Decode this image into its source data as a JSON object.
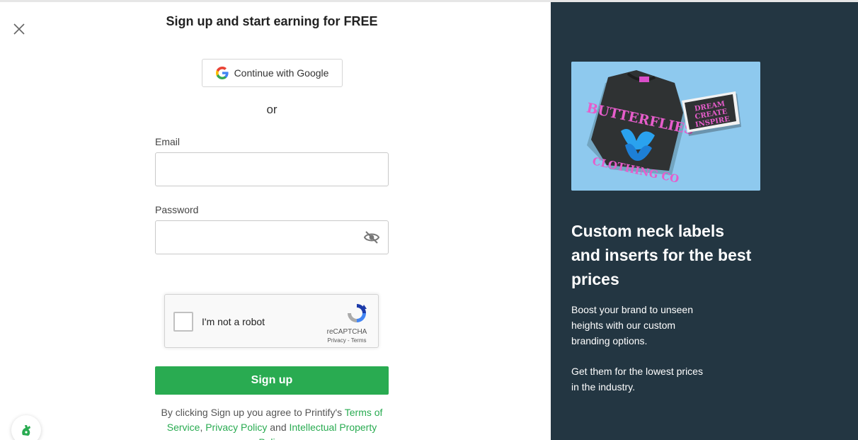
{
  "dialog": {
    "title": "Sign up and start earning for FREE",
    "google_label": "Continue with Google",
    "or_label": "or"
  },
  "form": {
    "email_label": "Email",
    "email_value": "",
    "password_label": "Password",
    "password_value": "",
    "captcha_label": "I'm not a robot",
    "captcha_brand": "reCAPTCHA",
    "captcha_links": "Privacy - Terms",
    "submit_label": "Sign up"
  },
  "legal": {
    "prefix": "By clicking Sign up you agree to Printify's",
    "terms": "Terms of Service",
    "separator": ",",
    "privacy": "Privacy Policy",
    "and": "and",
    "ip": "Intellectual Property Policy"
  },
  "promo": {
    "image_caption": "T-shirt mockup with neck label and insert card",
    "shirt_text": "BUTTERFLIES",
    "shirt_bottom_text": "CLOTHING CO",
    "card_line_1": "DREAM",
    "card_line_2": "CREATE",
    "card_line_3": "INSPIRE",
    "title": "Custom neck labels and inserts for the best prices",
    "text_1": "Boost your brand to unseen heights with our custom branding options.",
    "text_2": "Get them for the lowest prices in the industry."
  },
  "colors": {
    "accent": "#29ab51",
    "panel": "#233642",
    "promo_bg": "#8ec9ee"
  },
  "icons": {
    "close": "close-icon",
    "google": "google-icon",
    "eye": "eye-slash-icon",
    "recaptcha": "recaptcha-icon",
    "chat": "chat-icon"
  }
}
